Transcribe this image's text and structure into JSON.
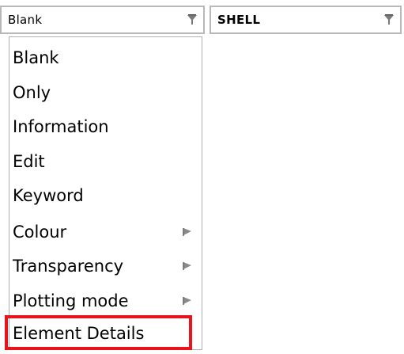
{
  "left_dropdown": {
    "value": "Blank",
    "icon": "funnel-icon"
  },
  "right_dropdown": {
    "value": "SHELL",
    "icon": "funnel-icon"
  },
  "menu": {
    "items": [
      {
        "label": "Blank",
        "submenu": false
      },
      {
        "label": "Only",
        "submenu": false
      },
      {
        "label": "Information",
        "submenu": false
      },
      {
        "label": "Edit",
        "submenu": false
      },
      {
        "label": "Keyword",
        "submenu": false
      },
      {
        "label": "Colour",
        "submenu": true
      },
      {
        "label": "Transparency",
        "submenu": true
      },
      {
        "label": "Plotting mode",
        "submenu": true
      },
      {
        "label": "Element Details",
        "submenu": false
      }
    ],
    "highlighted_item": "Element Details",
    "highlight_color": "#e8131b"
  }
}
